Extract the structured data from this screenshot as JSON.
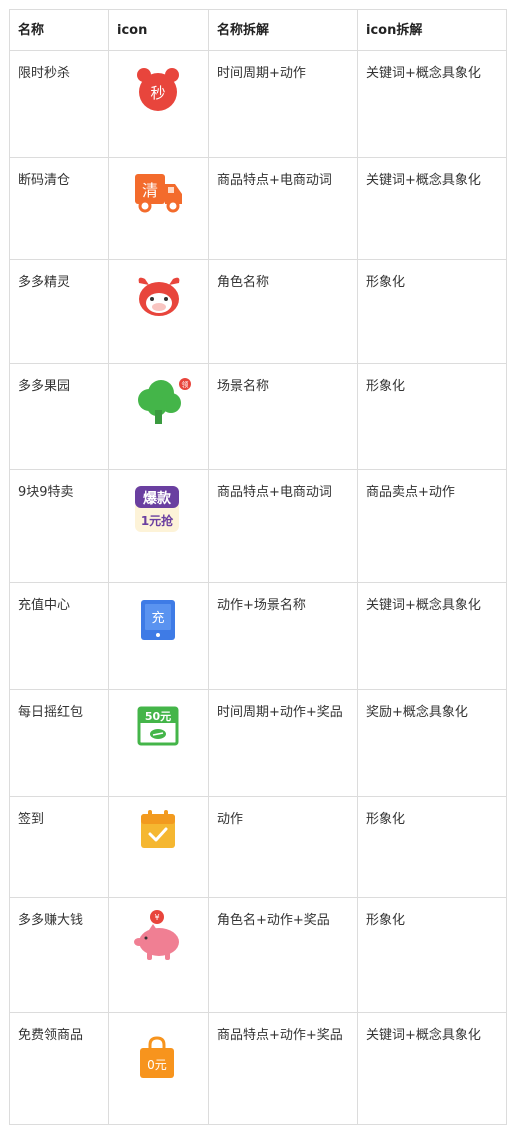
{
  "headers": [
    "名称",
    "icon",
    "名称拆解",
    "icon拆解"
  ],
  "rows": [
    {
      "name": "限时秒杀",
      "icon": "alarm-clock-icon",
      "icon_text": "秒",
      "breakdown": "时间周期+动作",
      "icon_breakdown": "关键词+概念具象化"
    },
    {
      "name": "断码清仓",
      "icon": "delivery-truck-icon",
      "icon_text": "清",
      "breakdown": "商品特点+电商动词",
      "icon_breakdown": "关键词+概念具象化"
    },
    {
      "name": "多多精灵",
      "icon": "cow-mascot-icon",
      "icon_text": "",
      "breakdown": "角色名称",
      "icon_breakdown": "形象化"
    },
    {
      "name": "多多果园",
      "icon": "tree-icon",
      "icon_text": "",
      "breakdown": "场景名称",
      "icon_breakdown": "形象化"
    },
    {
      "name": "9块9特卖",
      "icon": "hot-sale-badge-icon",
      "icon_text": [
        "爆款",
        "1元抢"
      ],
      "breakdown": "商品特点+电商动词",
      "icon_breakdown": "商品卖点+动作"
    },
    {
      "name": "充值中心",
      "icon": "tablet-icon",
      "icon_text": "充",
      "breakdown": "动作+场景名称",
      "icon_breakdown": "关键词+概念具象化"
    },
    {
      "name": "每日摇红包",
      "icon": "cash-voucher-icon",
      "icon_text": "50元",
      "breakdown": "时间周期+动作+奖品",
      "icon_breakdown": "奖励+概念具象化"
    },
    {
      "name": "签到",
      "icon": "calendar-check-icon",
      "icon_text": "",
      "breakdown": "动作",
      "icon_breakdown": "形象化"
    },
    {
      "name": "多多赚大钱",
      "icon": "piggy-bank-icon",
      "icon_text": "¥",
      "breakdown": "角色名+动作+奖品",
      "icon_breakdown": "形象化"
    },
    {
      "name": "免费领商品",
      "icon": "shopping-bag-icon",
      "icon_text": "0元",
      "breakdown": "商品特点+动作+奖品",
      "icon_breakdown": "关键词+概念具象化"
    }
  ],
  "colors": {
    "red": "#e8453c",
    "orange": "#f36b2c",
    "green": "#44b549",
    "blue": "#3e7be6",
    "yellow": "#f5b731",
    "pink": "#f07f93",
    "bag": "#f7941d"
  }
}
